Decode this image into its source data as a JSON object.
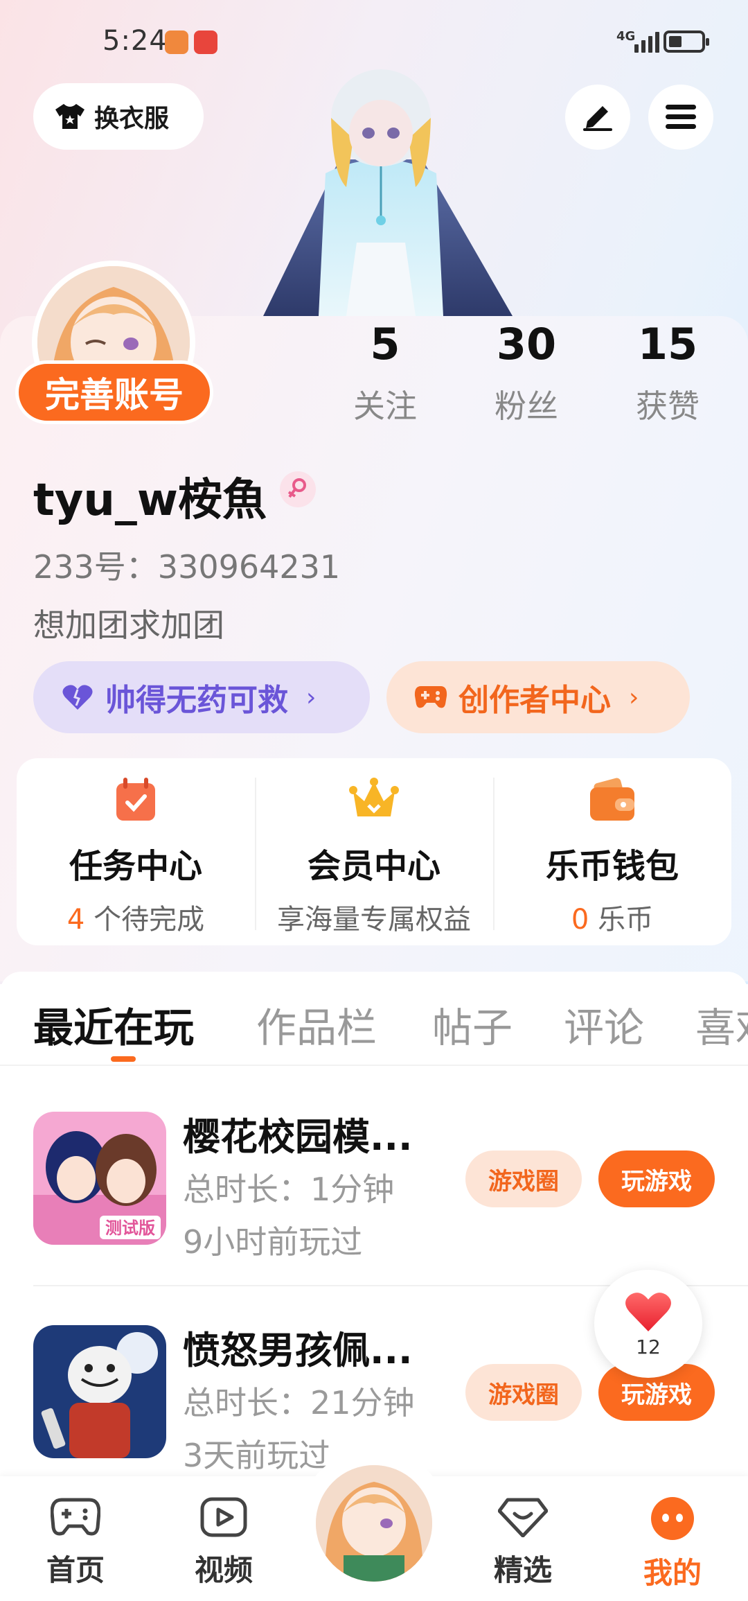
{
  "status_bar": {
    "time": "5:24",
    "network": "4G",
    "battery_level": 0.3
  },
  "header": {
    "dress_label": "换衣服",
    "edit_icon": "pen-icon",
    "menu_icon": "hamburger-menu-icon"
  },
  "profile": {
    "complete_badge": "完善账号",
    "stats": [
      {
        "value": "5",
        "label": "关注"
      },
      {
        "value": "30",
        "label": "粉丝"
      },
      {
        "value": "15",
        "label": "获赞"
      }
    ],
    "username": "tyu_w桉魚",
    "gender_icon": "female-icon",
    "user_id": "233号：330964231",
    "bio": "想加团求加团",
    "tag_left": "帅得无药可救",
    "tag_right": "创作者中心"
  },
  "services": [
    {
      "title": "任务中心",
      "highlight": "4",
      "sub": " 个待完成",
      "icon": "calendar-check-icon"
    },
    {
      "title": "会员中心",
      "highlight": "",
      "sub": "享海量专属权益",
      "icon": "crown-icon"
    },
    {
      "title": "乐币钱包",
      "highlight": "0",
      "sub": " 乐币",
      "icon": "wallet-icon"
    }
  ],
  "tabs": [
    "最近在玩",
    "作品栏",
    "帖子",
    "评论",
    "喜欢"
  ],
  "active_tab": 0,
  "games": [
    {
      "title": "樱花校园模...",
      "duration": "总时长：1分钟",
      "last_played": "9小时前玩过",
      "circle_btn": "游戏圈",
      "play_btn": "玩游戏"
    },
    {
      "title": "愤怒男孩佩...",
      "duration": "总时长：21分钟",
      "last_played": "3天前玩过",
      "circle_btn": "游戏圈",
      "play_btn": "玩游戏"
    }
  ],
  "like_bubble": {
    "count": "12"
  },
  "bottom_nav": [
    {
      "label": "首页",
      "icon": "gamepad-icon"
    },
    {
      "label": "视频",
      "icon": "video-play-icon"
    },
    {
      "label": "精选",
      "icon": "heart-diamond-icon"
    },
    {
      "label": "我的",
      "icon": "smile-face-icon"
    }
  ],
  "colors": {
    "accent": "#fb6a1f",
    "purple": "#6a55d8"
  }
}
